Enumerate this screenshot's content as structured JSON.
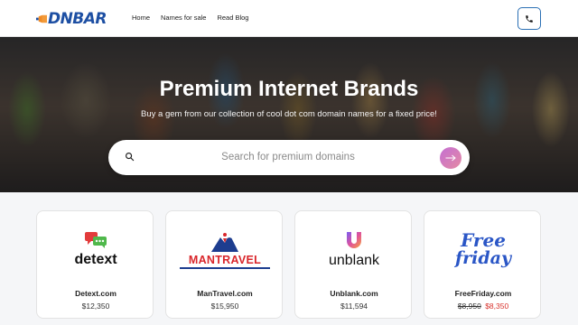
{
  "brand": {
    "name": "DNBAR",
    "accent": "#1d4fa3",
    "logo_shape_color": "#f08a24"
  },
  "nav": {
    "items": [
      "Home",
      "Names for sale",
      "Read Blog"
    ]
  },
  "header": {
    "phone_icon": "phone-icon"
  },
  "hero": {
    "title": "Premium Internet Brands",
    "subtitle": "Buy a gem from our collection of cool dot com domain names for a fixed price!"
  },
  "search": {
    "placeholder": "Search for premium domains",
    "value": "",
    "button_icon": "arrow-right-icon"
  },
  "domains": [
    {
      "logo_text": "detext",
      "name": "Detext.com",
      "price": "$12,350"
    },
    {
      "logo_text": "MANTRAVEL",
      "name": "ManTravel.com",
      "price": "$15,950"
    },
    {
      "logo_text": "unblank",
      "name": "Unblank.com",
      "price": "$11,594"
    },
    {
      "logo_text_1": "Free",
      "logo_text_2": "friday",
      "name": "FreeFriday.com",
      "old_price": "$8,950",
      "new_price": "$8,350"
    }
  ]
}
